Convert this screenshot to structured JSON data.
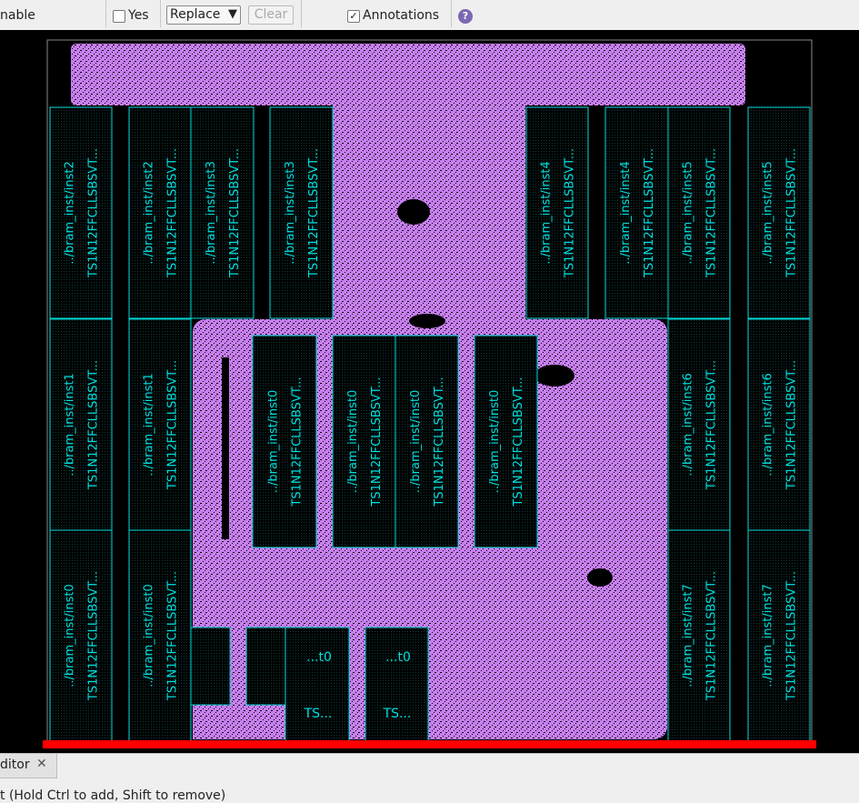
{
  "toolbar": {
    "enable_label": "nable",
    "yes_label": "Yes",
    "mode_select": "Replace",
    "clear_label": "Clear",
    "annotations_label": "Annotations",
    "help_symbol": "?"
  },
  "layout": {
    "top_label": "...t0",
    "bottom_label": "TS...",
    "macros": [
      {
        "top": "../bram_inst/inst2",
        "bottom": "TS1N12FFCLLSBSVT..."
      },
      {
        "top": "../bram_inst/inst2",
        "bottom": "TS1N12FFCLLSBSVT..."
      },
      {
        "top": "../bram_inst/inst3",
        "bottom": "TS1N12FFCLLSBSVT..."
      },
      {
        "top": "../bram_inst/inst3",
        "bottom": "TS1N12FFCLLSBSVT..."
      },
      {
        "top": "../bram_inst/inst4",
        "bottom": "TS1N12FFCLLSBSVT..."
      },
      {
        "top": "../bram_inst/inst4",
        "bottom": "TS1N12FFCLLSBSVT..."
      },
      {
        "top": "../bram_inst/inst5",
        "bottom": "TS1N12FFCLLSBSVT..."
      },
      {
        "top": "../bram_inst/inst5",
        "bottom": "TS1N12FFCLLSBSVT..."
      },
      {
        "top": "../bram_inst/inst1",
        "bottom": "TS1N12FFCLLSBSVT..."
      },
      {
        "top": "../bram_inst/inst1",
        "bottom": "TS1N12FFCLLSBSVT..."
      },
      {
        "top": "../bram_inst/inst0",
        "bottom": "TS1N12FFCLLSBSVT..."
      },
      {
        "top": "../bram_inst/inst0",
        "bottom": "TS1N12FFCLLSBSVT..."
      },
      {
        "top": "../bram_inst/inst0",
        "bottom": "TS1N12FFCLLSBSVT..."
      },
      {
        "top": "../bram_inst/inst0",
        "bottom": "TS1N12FFCLLSBSVT..."
      },
      {
        "top": "../bram_inst/inst6",
        "bottom": "TS1N12FFCLLSBSVT..."
      },
      {
        "top": "../bram_inst/inst6",
        "bottom": "TS1N12FFCLLSBSVT..."
      },
      {
        "top": "../bram_inst/inst0",
        "bottom": "TS1N12FFCLLSBSVT..."
      },
      {
        "top": "../bram_inst/inst0",
        "bottom": "TS1N12FFCLLSBSVT..."
      },
      {
        "top": "../bram_inst/inst7",
        "bottom": "TS1N12FFCLLSBSVT..."
      },
      {
        "top": "../bram_inst/inst7",
        "bottom": "TS1N12FFCLLSBSVT..."
      }
    ]
  },
  "bottom_panel": {
    "tab_label": "ditor",
    "close_symbol": "✕",
    "status_text": "t (Hold Ctrl to add, Shift to remove)"
  },
  "colors": {
    "cell_fill": "#c77ff0",
    "macro_outline": "#00d8d8",
    "macro_text": "#00e0e0",
    "die_outline": "#888888",
    "marker": "#ff0000"
  },
  "icons": [
    "help-icon",
    "close-icon",
    "checkbox-checked-icon",
    "checkbox-unchecked-icon",
    "dropdown-arrow-icon"
  ]
}
